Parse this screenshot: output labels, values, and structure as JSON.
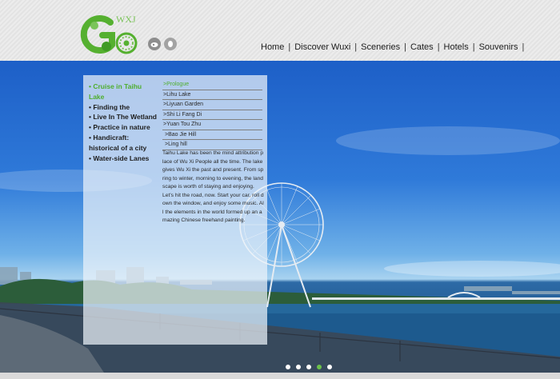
{
  "logo": {
    "letters": "WXJ"
  },
  "social": [
    {
      "name": "weibo"
    },
    {
      "name": "qq"
    }
  ],
  "nav": {
    "items": [
      {
        "label": "Home"
      },
      {
        "label": "Discover Wuxi"
      },
      {
        "label": "Sceneries"
      },
      {
        "label": "Cates"
      },
      {
        "label": "Hotels"
      },
      {
        "label": "Souvenirs"
      }
    ],
    "separator": "|"
  },
  "menu": {
    "items": [
      {
        "label": "• Cruise in Taihu Lake",
        "active": true
      },
      {
        "label": "• Finding the"
      },
      {
        "label": "• Live In The Wetland"
      },
      {
        "label": "• Practice in nature"
      },
      {
        "label": "• Handicraft: historical of a city"
      },
      {
        "label": "• Water-side Lanes"
      }
    ]
  },
  "submenu": {
    "items": [
      {
        "label": ">Prologue",
        "active": true
      },
      {
        "label": ">Lihu Lake"
      },
      {
        "label": ">Liyuan Garden"
      },
      {
        "label": ">Shi Li Fang Di"
      },
      {
        "label": ">Yuan Tou Zhu"
      },
      {
        "label": ">Bao Jie Hill"
      },
      {
        "label": ">Ling hill"
      }
    ]
  },
  "description": {
    "p1": "Taihu Lake has been the mind attribution place of Wu Xi People all the time. The lake gives Wu Xi the past and present. From spring to winter, morning to evening, the landscape is worth of staying and enjoying.",
    "p2": "Let’s hit the road, now. Start your car, roll down the window, and enjoy some music. All the elements in the world formed up an amazing Chinese freehand painting."
  },
  "slider": {
    "count": 5,
    "active_index": 3
  },
  "colors": {
    "accent_green": "#4fae2e",
    "dot_active": "#6cc24a"
  }
}
